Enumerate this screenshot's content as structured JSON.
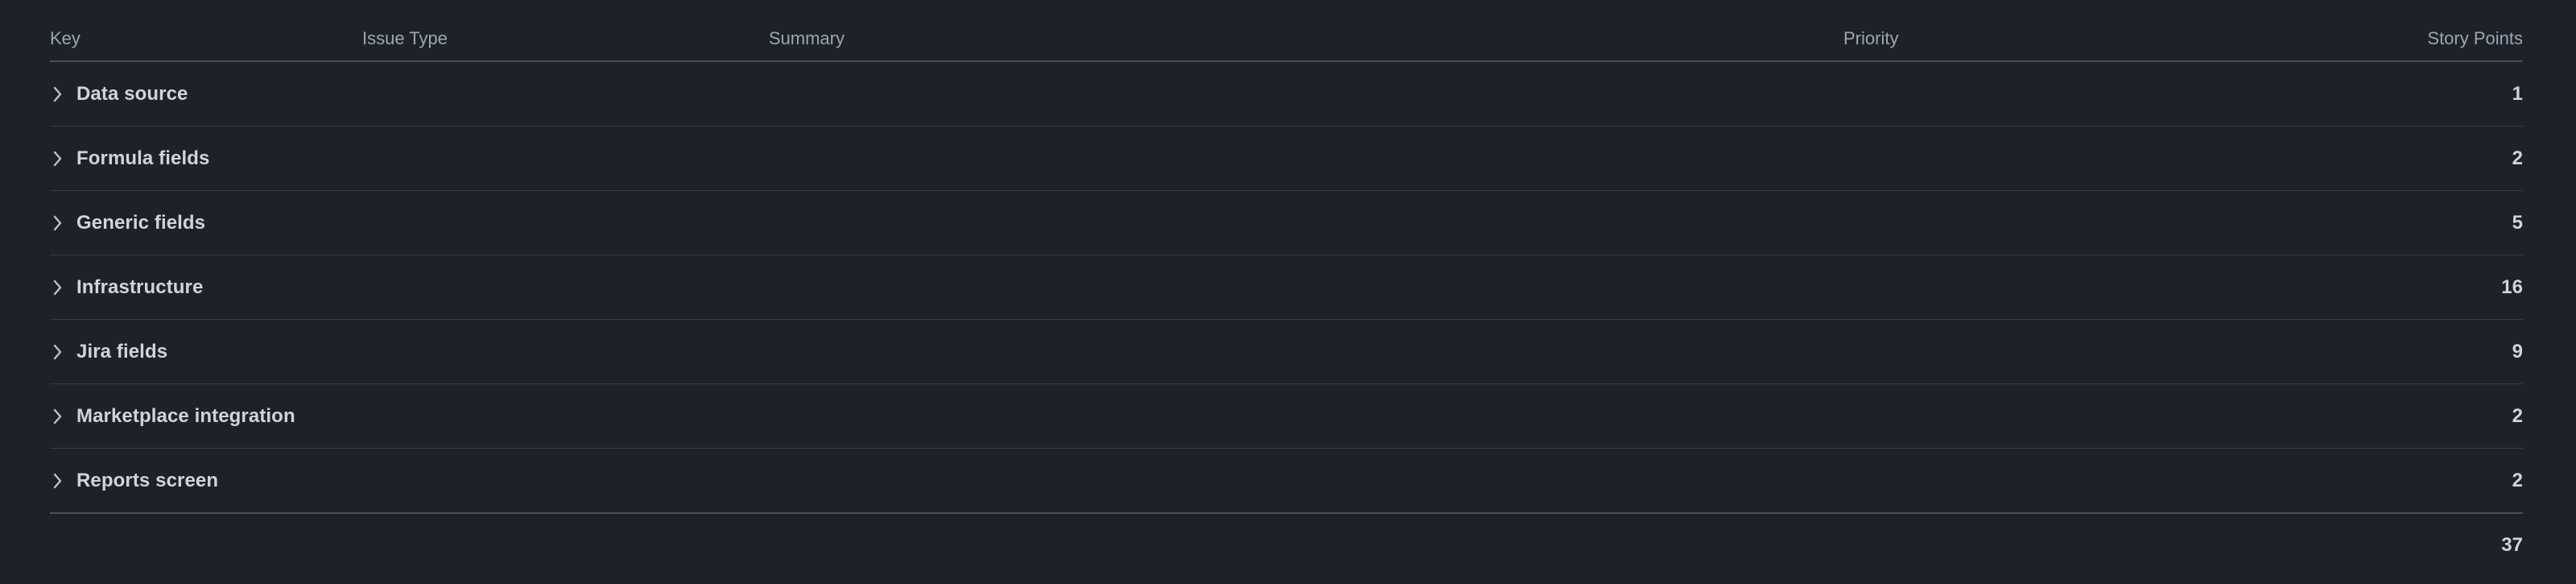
{
  "table": {
    "columns": [
      {
        "key": "key",
        "label": "Key"
      },
      {
        "key": "issue_type",
        "label": "Issue Type"
      },
      {
        "key": "summary",
        "label": "Summary"
      },
      {
        "key": "priority",
        "label": "Priority"
      },
      {
        "key": "story_points",
        "label": "Story Points"
      }
    ],
    "rows": [
      {
        "key": "Data source",
        "issue_type": "",
        "summary": "",
        "priority": "",
        "story_points": "1"
      },
      {
        "key": "Formula fields",
        "issue_type": "",
        "summary": "",
        "priority": "",
        "story_points": "2"
      },
      {
        "key": "Generic fields",
        "issue_type": "",
        "summary": "",
        "priority": "",
        "story_points": "5"
      },
      {
        "key": "Infrastructure",
        "issue_type": "",
        "summary": "",
        "priority": "",
        "story_points": "16"
      },
      {
        "key": "Jira fields",
        "issue_type": "",
        "summary": "",
        "priority": "",
        "story_points": "9"
      },
      {
        "key": "Marketplace integration",
        "issue_type": "",
        "summary": "",
        "priority": "",
        "story_points": "2"
      },
      {
        "key": "Reports screen",
        "issue_type": "",
        "summary": "",
        "priority": "",
        "story_points": "2"
      }
    ],
    "total": {
      "label": "",
      "story_points": "37"
    },
    "expand_icon": "chevron-right-icon",
    "colors": {
      "background": "#1e2228",
      "header_text": "#9aa6b4",
      "row_text": "#ccd5df",
      "row_divider": "#343c47",
      "header_divider": "#414d5c",
      "total_divider": "#46525f"
    }
  }
}
